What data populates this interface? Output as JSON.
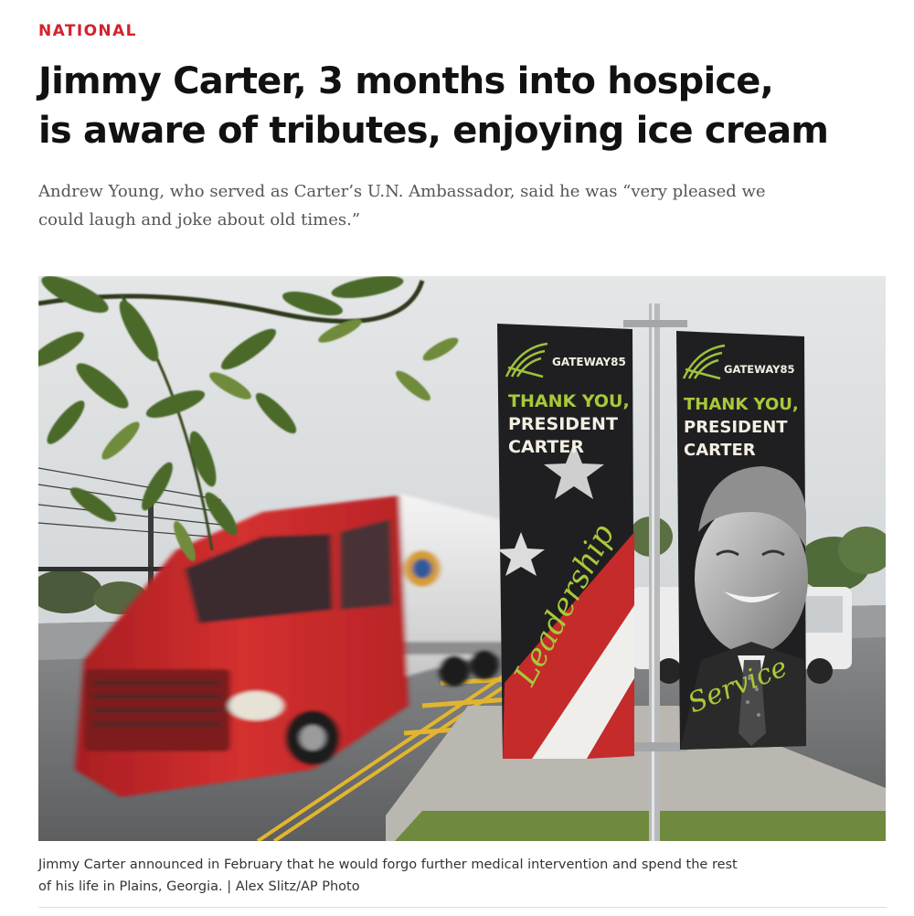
{
  "article": {
    "section": "NATIONAL",
    "headline_lines": [
      "Jimmy Carter, 3 months into hospice,",
      "is aware of tributes, enjoying ice cream"
    ],
    "dek_lines": [
      "Andrew Young, who served as Carter’s U.N. Ambassador, said he was “very pleased we",
      "could laugh and joke about old times.”"
    ]
  },
  "photo": {
    "banners": [
      {
        "brand": "GATEWAY85",
        "message_lines": [
          "THANK YOU,",
          "PRESIDENT",
          "CARTER"
        ],
        "script_word": "Leadership"
      },
      {
        "brand": "GATEWAY85",
        "message_lines": [
          "THANK YOU,",
          "PRESIDENT",
          "CARTER"
        ],
        "script_word": "Service"
      }
    ],
    "colors": {
      "sky": "#d9dcde",
      "truck_red": "#c8262a",
      "banner_dark": "#1f1f22",
      "banner_green": "#a9c83a",
      "banner_text": "#f3efe2"
    }
  },
  "caption": {
    "lines": [
      "Jimmy Carter announced in February that he would forgo further medical intervention and spend the rest",
      "of his life in Plains, Georgia. | Alex Slitz/AP Photo"
    ]
  },
  "theme": {
    "section_color": "#d3222e",
    "headline_color": "#111111",
    "dek_color": "#555555"
  }
}
